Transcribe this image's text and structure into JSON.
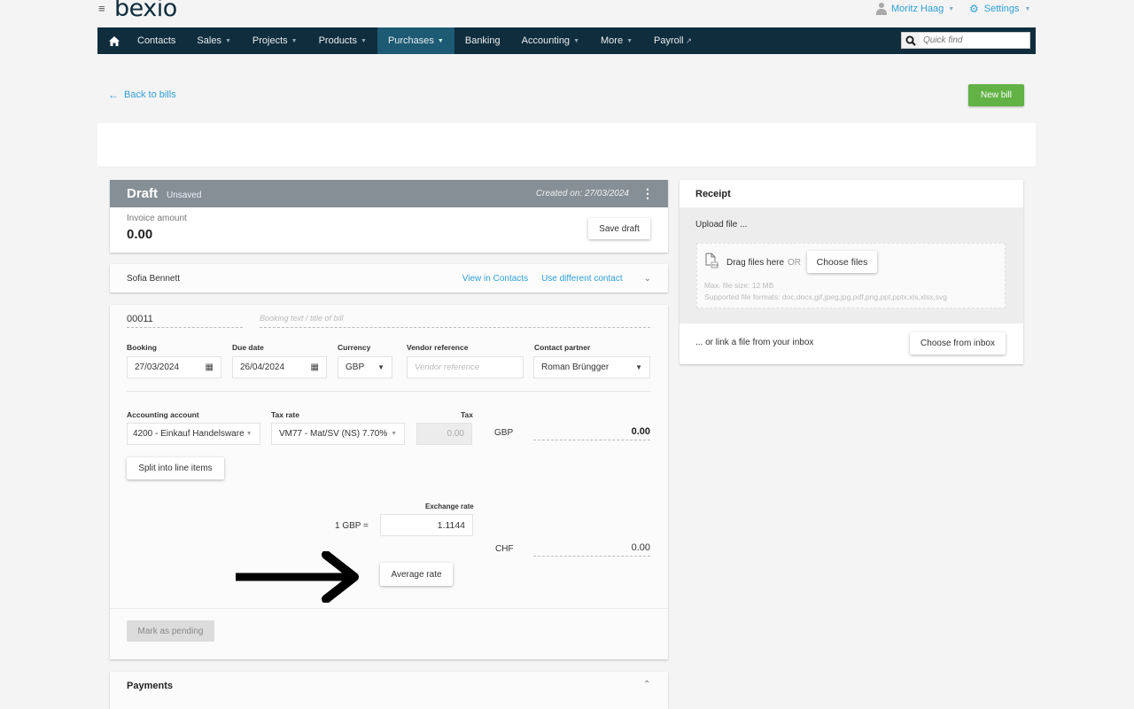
{
  "app": {
    "logo": "bexio",
    "menu_icon": "hamburger-icon",
    "user_name": "Moritz Haag",
    "settings_label": "Settings"
  },
  "nav": {
    "items": [
      {
        "label": "Contacts",
        "dropdown": false
      },
      {
        "label": "Sales",
        "dropdown": true
      },
      {
        "label": "Projects",
        "dropdown": true
      },
      {
        "label": "Products",
        "dropdown": true
      },
      {
        "label": "Purchases",
        "dropdown": true,
        "active": true
      },
      {
        "label": "Banking",
        "dropdown": false
      },
      {
        "label": "Accounting",
        "dropdown": true
      },
      {
        "label": "More",
        "dropdown": true
      },
      {
        "label": "Payroll",
        "external": true
      }
    ],
    "quick_find_placeholder": "Quick find"
  },
  "page": {
    "back_link": "Back to bills",
    "new_bill_label": "New bill",
    "accent_color": "#2e9fd4",
    "success_color": "#62b246",
    "nav_color": "#0f2d3d"
  },
  "draft": {
    "status": "Draft",
    "substatus": "Unsaved",
    "created_on": "Created on: 27/03/2024",
    "invoice_amount_label": "Invoice amount",
    "invoice_amount": "0.00",
    "save_draft_label": "Save draft"
  },
  "contact": {
    "name": "Sofia Bennett",
    "view_link": "View in Contacts",
    "change_link": "Use different contact"
  },
  "form": {
    "bill_number": "00011",
    "booking_text_placeholder": "Booking text / title of bill",
    "booking_label": "Booking",
    "booking_date": "27/03/2024",
    "due_label": "Due date",
    "due_date": "26/04/2024",
    "currency_label": "Currency",
    "currency": "GBP",
    "vendor_ref_label": "Vendor reference",
    "vendor_ref_placeholder": "Vendor reference",
    "contact_partner_label": "Contact partner",
    "contact_partner": "Roman Brüngger",
    "account_label": "Accounting account",
    "account": "4200 - Einkauf Handelsware",
    "tax_rate_label": "Tax rate",
    "tax_rate": "VM77 - Mat/SV (NS) 7.70%",
    "tax_label": "Tax",
    "tax_value": "0.00",
    "amount_currency": "GBP",
    "amount": "0.00",
    "split_label": "Split into line items",
    "exchange_rate_label": "Exchange rate",
    "exchange_prefix": "1 GBP =",
    "exchange_rate": "1.1144",
    "chf_label": "CHF",
    "chf_amount": "0.00",
    "average_rate_label": "Average rate",
    "mark_pending_label": "Mark as pending"
  },
  "payments": {
    "title": "Payments"
  },
  "receipt": {
    "title": "Receipt",
    "upload_label": "Upload file ...",
    "drag_text": "Drag files here",
    "or_text": "OR",
    "choose_files_label": "Choose files",
    "max_size": "Max. file size: 12 MB",
    "formats": "Supported file formats: doc,docx,gif,jpeg,jpg,pdf,png,ppt,pptx,xls,xlsx,svg",
    "inbox_text": "... or link a file from your inbox",
    "choose_inbox_label": "Choose from inbox"
  }
}
